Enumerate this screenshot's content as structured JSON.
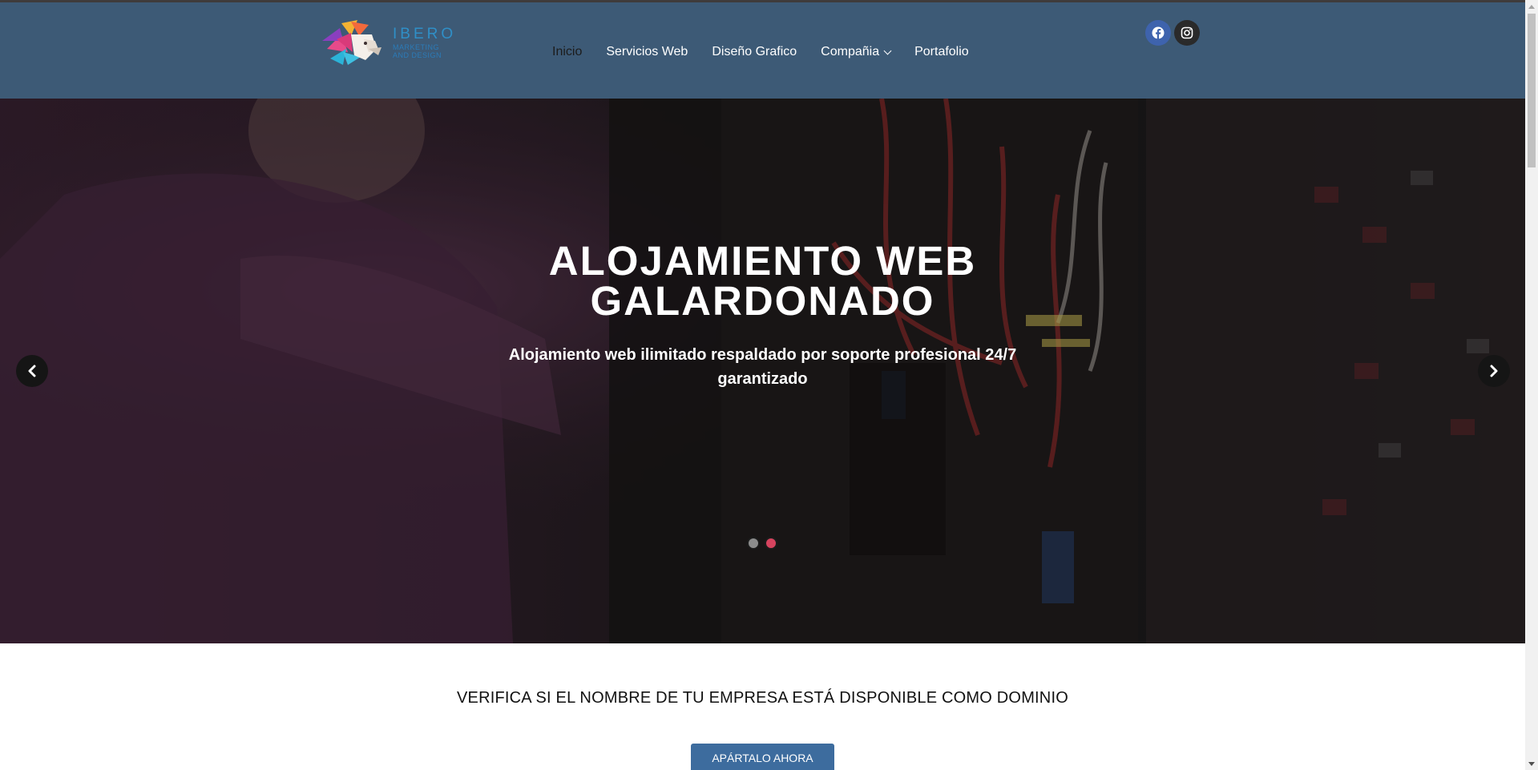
{
  "logo": {
    "name": "IBERO",
    "tagline_line1": "MARKETING",
    "tagline_line2": "AND DESIGN",
    "icon": "lion-head-logo"
  },
  "nav": {
    "items": [
      {
        "label": "Inicio",
        "active": true
      },
      {
        "label": "Servicios Web",
        "active": false
      },
      {
        "label": "Diseño Grafico",
        "active": false
      },
      {
        "label": "Compañia",
        "active": false,
        "has_dropdown": true
      },
      {
        "label": "Portafolio",
        "active": false
      }
    ]
  },
  "social": {
    "facebook_icon": "facebook-icon",
    "instagram_icon": "instagram-icon"
  },
  "hero": {
    "title_line1": "ALOJAMIENTO WEB",
    "title_line2": "GALARDONADO",
    "subtitle": "Alojamiento web ilimitado respaldado por soporte profesional 24/7 garantizado",
    "slides_count": 2,
    "active_slide": 2
  },
  "domain": {
    "title": "VERIFICA SI EL NOMBRE DE TU EMPRESA ESTÁ DISPONIBLE COMO DOMINIO",
    "button_label": "APÁRTALO AHORA"
  },
  "colors": {
    "header_bg": "#3d5a76",
    "accent_dot": "#d6435e",
    "button_bg": "#3d6c9e"
  }
}
